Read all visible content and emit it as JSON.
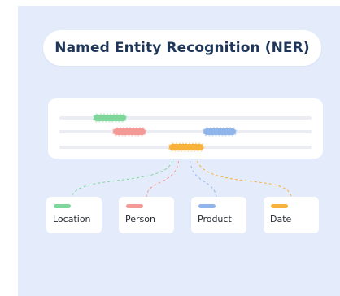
{
  "title": "Named Entity Recognition (NER)",
  "colors": {
    "background": "#e4ecfb",
    "title_text": "#1f3658",
    "text_line": "#ebedf2",
    "location": "#7ed69b",
    "person": "#f49a96",
    "product": "#8fb5ea",
    "date": "#f7b23b"
  },
  "entities": [
    {
      "label": "Location",
      "color": "#7ed69b"
    },
    {
      "label": "Person",
      "color": "#f49a96"
    },
    {
      "label": "Product",
      "color": "#8fb5ea"
    },
    {
      "label": "Date",
      "color": "#f7b23b"
    }
  ]
}
